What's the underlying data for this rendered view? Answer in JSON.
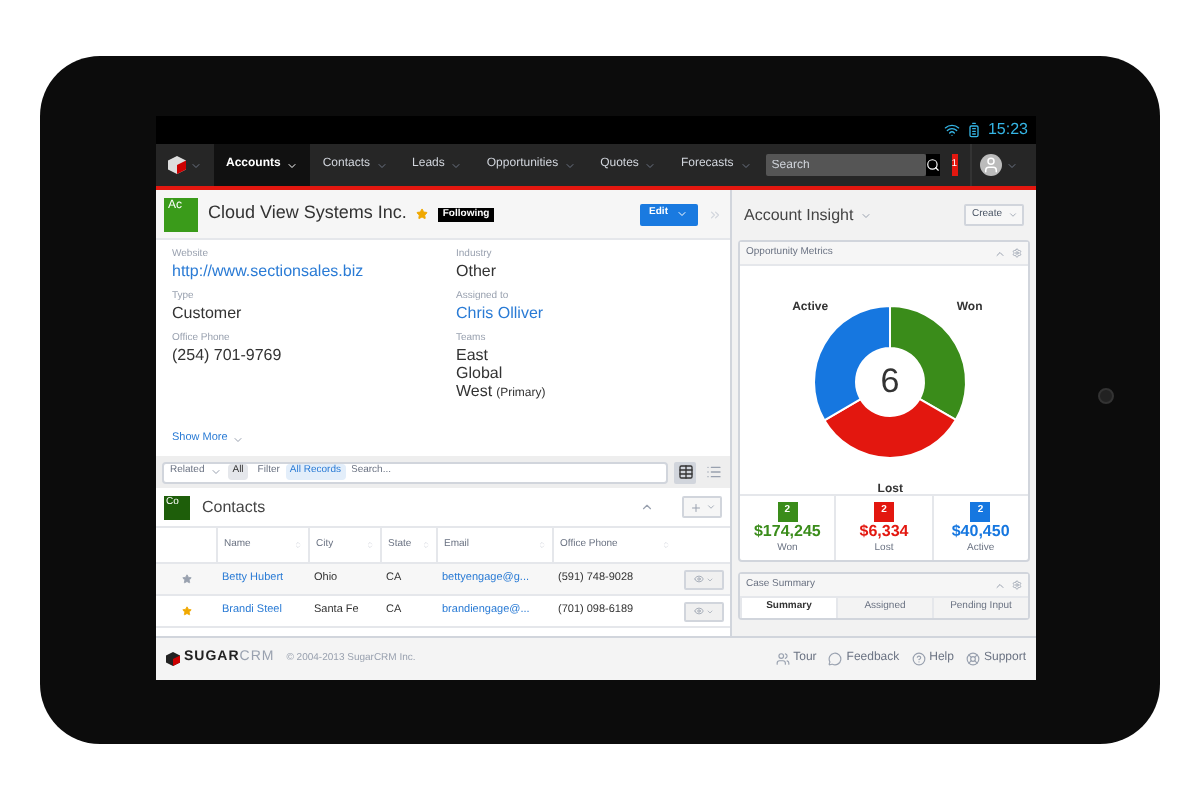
{
  "status_bar": {
    "time": "15:23"
  },
  "nav": {
    "items": [
      {
        "label": "Accounts",
        "selected": true
      },
      {
        "label": "Contacts",
        "selected": false
      },
      {
        "label": "Leads",
        "selected": false
      },
      {
        "label": "Opportunities",
        "selected": false
      },
      {
        "label": "Quotes",
        "selected": false
      },
      {
        "label": "Forecasts",
        "selected": false
      }
    ],
    "search": {
      "placeholder": "Search"
    },
    "notifications": "1"
  },
  "record": {
    "module_icon": "Ac",
    "title": "Cloud View Systems Inc.",
    "favorite": true,
    "following": "Following",
    "edit_button": "Edit",
    "left_fields": [
      {
        "label": "Website",
        "value": "http://www.sectionsales.biz",
        "kind": "link"
      },
      {
        "label": "Type",
        "value": "Customer",
        "kind": "text"
      },
      {
        "label": "Office Phone",
        "value": "(254) 701-9769",
        "kind": "text"
      }
    ],
    "right_fields": [
      {
        "label": "Industry",
        "value": "Other",
        "kind": "text"
      },
      {
        "label": "Assigned to",
        "value": "Chris Olliver",
        "kind": "link"
      },
      {
        "label": "Teams",
        "kind": "teams",
        "teams": [
          {
            "name": "East"
          },
          {
            "name": "Global"
          },
          {
            "name": "West",
            "note": "(Primary)"
          }
        ]
      }
    ],
    "show_more": "Show More"
  },
  "filter_bar": {
    "related": "Related",
    "related_value": "All",
    "filter": "Filter",
    "filter_value": "All Records",
    "placeholder": "Search...",
    "views": [
      {
        "kind": "table",
        "selected": true
      },
      {
        "kind": "list",
        "selected": false
      }
    ]
  },
  "subpanel": {
    "icon": "Co",
    "title": "Contacts",
    "columns": [
      "Name",
      "City",
      "State",
      "Email",
      "Office Phone"
    ],
    "rows": [
      {
        "favorite": false,
        "cells": [
          "Betty Hubert",
          "Ohio",
          "CA",
          "bettyengage@g...",
          "(591) 748-9028"
        ]
      },
      {
        "favorite": true,
        "cells": [
          "Brandi Steel",
          "Santa Fe",
          "CA",
          "brandiengage@...",
          "(701) 098-6189"
        ]
      }
    ]
  },
  "insight": {
    "title": "Account Insight",
    "create": "Create",
    "metrics": {
      "title": "Opportunity Metrics",
      "center": "6",
      "chart_data": {
        "type": "donut",
        "categories": [
          "Won",
          "Lost",
          "Active"
        ],
        "values": [
          33.3,
          33.3,
          33.4
        ]
      },
      "stats": [
        {
          "count": "2",
          "amount": "$174,245",
          "label": "Won",
          "color": "#3a8c1a"
        },
        {
          "count": "2",
          "amount": "$6,334",
          "label": "Lost",
          "color": "#e3170f"
        },
        {
          "count": "2",
          "amount": "$40,450",
          "label": "Active",
          "color": "#1677e0"
        }
      ]
    },
    "case_summary": {
      "title": "Case Summary",
      "tabs": [
        {
          "label": "Summary",
          "selected": true
        },
        {
          "label": "Assigned",
          "selected": false
        },
        {
          "label": "Pending Input",
          "selected": false
        }
      ]
    }
  },
  "footer": {
    "logo": {
      "bold": "SUGAR",
      "light": "CRM"
    },
    "copyright": "© 2004-2013 SugarCRM Inc.",
    "links": [
      {
        "label": "Tour",
        "kind": "tour"
      },
      {
        "label": "Feedback",
        "kind": "feedback"
      },
      {
        "label": "Help",
        "kind": "help"
      },
      {
        "label": "Support",
        "kind": "support"
      }
    ]
  }
}
